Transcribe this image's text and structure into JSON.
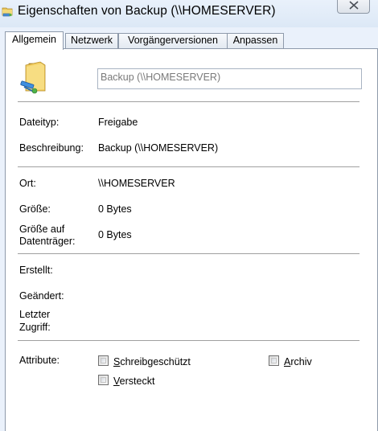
{
  "window": {
    "title": "Eigenschaften von Backup (\\\\HOMESERVER)"
  },
  "tabs": [
    {
      "label": "Allgemein",
      "active": true
    },
    {
      "label": "Netzwerk",
      "active": false
    },
    {
      "label": "Vorgängerversionen",
      "active": false
    },
    {
      "label": "Anpassen",
      "active": false
    }
  ],
  "general": {
    "name_value": "Backup (\\\\HOMESERVER)",
    "icon": "shared-folder-icon",
    "rows": [
      {
        "label": "Dateityp:",
        "value": "Freigabe"
      },
      {
        "label": "Beschreibung:",
        "value": "Backup (\\\\HOMESERVER)"
      },
      {
        "label": "Ort:",
        "value": "\\\\HOMESERVER"
      },
      {
        "label": "Größe:",
        "value": "0 Bytes"
      },
      {
        "label_line1": "Größe auf",
        "label_line2": "Datenträger:",
        "value": "0 Bytes"
      },
      {
        "label": "Erstellt:",
        "value": ""
      },
      {
        "label": "Geändert:",
        "value": ""
      },
      {
        "label_line1": "Letzter",
        "label_line2": "Zugriff:",
        "value": ""
      }
    ],
    "attributes": {
      "label": "Attribute:",
      "readonly": {
        "accel": "S",
        "rest": "chreibgeschützt",
        "checked": false
      },
      "archive": {
        "accel": "A",
        "rest": "rchiv",
        "checked": false
      },
      "hidden": {
        "accel": "V",
        "rest": "ersteckt",
        "checked": false
      }
    }
  },
  "colors": {
    "window_bg": "#eaf1fb",
    "panel_bg": "#ffffff",
    "border": "#8e9aab",
    "separator": "#a0a0a0",
    "placeholder_text": "#7a7a7a"
  }
}
